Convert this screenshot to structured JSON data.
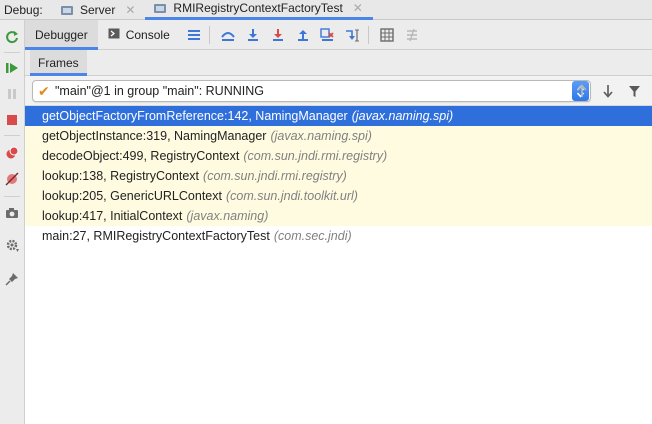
{
  "header": {
    "debug_label": "Debug:",
    "tabs": [
      {
        "label": "Server",
        "active": false
      },
      {
        "label": "RMIRegistryContextFactoryTest",
        "active": true
      }
    ],
    "close_glyph": "✕"
  },
  "toolbar": {
    "debugger_label": "Debugger",
    "console_label": "Console"
  },
  "frames_panel": {
    "tab_label": "Frames",
    "thread_selector": {
      "value": "\"main\"@1 in group \"main\": RUNNING"
    },
    "frames": [
      {
        "method": "getObjectFactoryFromReference:142, NamingManager",
        "package": "(javax.naming.spi)",
        "selected": true
      },
      {
        "method": "getObjectInstance:319, NamingManager",
        "package": "(javax.naming.spi)",
        "highlighted": true
      },
      {
        "method": "decodeObject:499, RegistryContext",
        "package": "(com.sun.jndi.rmi.registry)",
        "highlighted": true
      },
      {
        "method": "lookup:138, RegistryContext",
        "package": "(com.sun.jndi.rmi.registry)",
        "highlighted": true
      },
      {
        "method": "lookup:205, GenericURLContext",
        "package": "(com.sun.jndi.toolkit.url)",
        "highlighted": true
      },
      {
        "method": "lookup:417, InitialContext",
        "package": "(javax.naming)",
        "highlighted": true
      },
      {
        "method": "main:27, RMIRegistryContextFactoryTest",
        "package": "(com.sec.jndi)",
        "highlighted": false
      }
    ]
  },
  "colors": {
    "selection": "#2f6fdc",
    "highlight_row": "#fffbe0",
    "tab_underline": "#4a86e8"
  }
}
